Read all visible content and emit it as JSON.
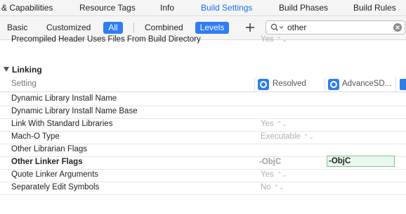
{
  "tabs": [
    {
      "label": "& Capabilities",
      "active": false
    },
    {
      "label": "Resource Tags",
      "active": false
    },
    {
      "label": "Info",
      "active": false
    },
    {
      "label": "Build Settings",
      "active": true
    },
    {
      "label": "Build Phases",
      "active": false
    },
    {
      "label": "Build Rules",
      "active": false
    }
  ],
  "filters": {
    "basic": "Basic",
    "customized": "Customized",
    "all": "All",
    "combined": "Combined",
    "levels": "Levels"
  },
  "search": {
    "value": "other"
  },
  "truncated_row": {
    "label": "Precompiled Header Uses Files From Build Directory",
    "value": "Yes"
  },
  "section": {
    "title": "Linking"
  },
  "columns": {
    "setting": "Setting",
    "resolved": "Resolved",
    "target": "AdvanceSD..."
  },
  "rows": [
    {
      "label": "Dynamic Library Install Name",
      "value": "",
      "bold": false
    },
    {
      "label": "Dynamic Library Install Name Base",
      "value": "",
      "bold": false
    },
    {
      "label": "Link With Standard Libraries",
      "value": "Yes",
      "stepper": true,
      "bold": false
    },
    {
      "label": "Mach-O Type",
      "value": "Executable",
      "stepper": true,
      "bold": false
    },
    {
      "label": "Other Librarian Flags",
      "value": "",
      "bold": false
    },
    {
      "label": "Other Linker Flags",
      "value": "-ObjC",
      "bold": true,
      "edit_value": "-ObjC"
    },
    {
      "label": "Quote Linker Arguments",
      "value": "Yes",
      "stepper": true,
      "bold": false
    },
    {
      "label": "Separately Edit Symbols",
      "value": "No",
      "stepper": true,
      "bold": false
    }
  ],
  "colors": {
    "accent": "#2f7cf6",
    "active_tab": "#1a6ef0",
    "edit_bg": "#e9f7ec",
    "edit_border": "#7fc58d"
  },
  "icons": [
    "plus-icon",
    "search-icon",
    "clear-icon",
    "disclosure-triangle-icon",
    "target-icon",
    "document-icon",
    "stepper-icon"
  ]
}
